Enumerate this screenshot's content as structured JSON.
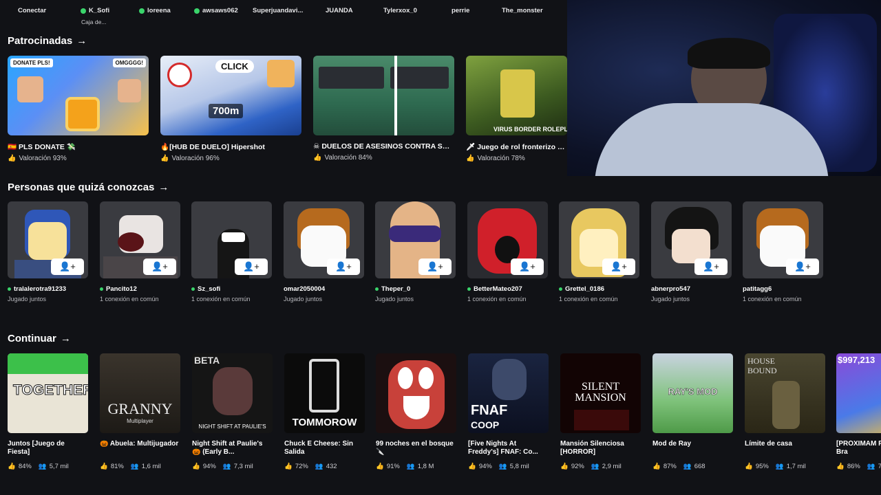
{
  "topbar": {
    "connect": "Conectar",
    "connect_sub": "Caja de...",
    "friends": [
      {
        "name": "K_Sofi",
        "online": true
      },
      {
        "name": "loreena",
        "online": true
      },
      {
        "name": "awsaws062",
        "online": true
      },
      {
        "name": "Superjuandavi...",
        "online": false
      },
      {
        "name": "JUANDA",
        "online": false
      },
      {
        "name": "Tylerxox_0",
        "online": false
      },
      {
        "name": "perrie",
        "online": false
      },
      {
        "name": "The_monster",
        "online": false
      }
    ]
  },
  "sponsored": {
    "title": "Patrocinadas",
    "items": [
      {
        "name": "🇪🇸 PLS DONATE 💸",
        "rating": "Valoración 93%",
        "badge1": "DONATE PLS!",
        "badge2": "OMGGGG!"
      },
      {
        "name": "🔥[HUB DE DUELO] Hipershot",
        "rating": "Valoración 96%",
        "overlay1": "CLICK",
        "overlay2": "700m"
      },
      {
        "name": "☠ DUELOS DE ASESINOS CONTRA SHE...",
        "rating": "Valoración 84%"
      },
      {
        "name": "🗡 Juego de rol fronterizo cor",
        "rating": "Valoración 78%",
        "overlay1": "VIRUS BORDER ROLEPL"
      }
    ]
  },
  "people": {
    "title": "Personas que quizá conozcas",
    "items": [
      {
        "name": "tralalerotra91233",
        "sub": "Jugado juntos",
        "online": true
      },
      {
        "name": "Pancito12",
        "sub": "1 conexión en común",
        "online": true
      },
      {
        "name": "Sz_sofi",
        "sub": "1 conexión en común",
        "online": true
      },
      {
        "name": "omar2050004",
        "sub": "Jugado juntos",
        "online": false
      },
      {
        "name": "Theper_0",
        "sub": "Jugado juntos",
        "online": true
      },
      {
        "name": "BetterMateo207",
        "sub": "1 conexión en común",
        "online": true
      },
      {
        "name": "Grettel_0186",
        "sub": "1 conexión en común",
        "online": true
      },
      {
        "name": "abnerpro547",
        "sub": "Jugado juntos",
        "online": false
      },
      {
        "name": "patitagg6",
        "sub": "1 conexión en común",
        "online": false
      }
    ]
  },
  "continue": {
    "title": "Continuar",
    "items": [
      {
        "name": "Juntos [Juego de Fiesta]",
        "rating": "84%",
        "players": "5,7 mil",
        "art": "TOGETHER"
      },
      {
        "name": "🎃 Abuela: Multijugador",
        "rating": "81%",
        "players": "1,6 mil",
        "art": "GRANNY",
        "art2": "Multiplayer"
      },
      {
        "name": "Night Shift at Paulie's 🎃 (Early B...",
        "rating": "94%",
        "players": "7,3 mil",
        "art": "BETA",
        "art2": "NIGHT SHIFT AT PAULIE'S"
      },
      {
        "name": "Chuck E Cheese: Sin Salida",
        "rating": "72%",
        "players": "432",
        "art": "TOMMOROW"
      },
      {
        "name": "99 noches en el bosque 🔪",
        "rating": "91%",
        "players": "1,8 M"
      },
      {
        "name": "[Five Nights At Freddy's] FNAF: Co...",
        "rating": "94%",
        "players": "5,8 mil",
        "art": "FNAF",
        "art2": "COOP"
      },
      {
        "name": "Mansión Silenciosa [HORROR]",
        "rating": "92%",
        "players": "2,9 mil",
        "art": "SILENT",
        "art2": "MANSION"
      },
      {
        "name": "Mod de Ray",
        "rating": "87%",
        "players": "668",
        "art": "RAY'S MOD"
      },
      {
        "name": "Límite de casa",
        "rating": "95%",
        "players": "1,7 mil",
        "art": "HOUSE",
        "art2": "BOUND"
      },
      {
        "name": "[PRÓXIMAM Roba un Bra",
        "rating": "86%",
        "players": "7",
        "art": "$997,213"
      }
    ]
  },
  "colors": {
    "online": "#3ad46b",
    "bg": "#111216"
  }
}
